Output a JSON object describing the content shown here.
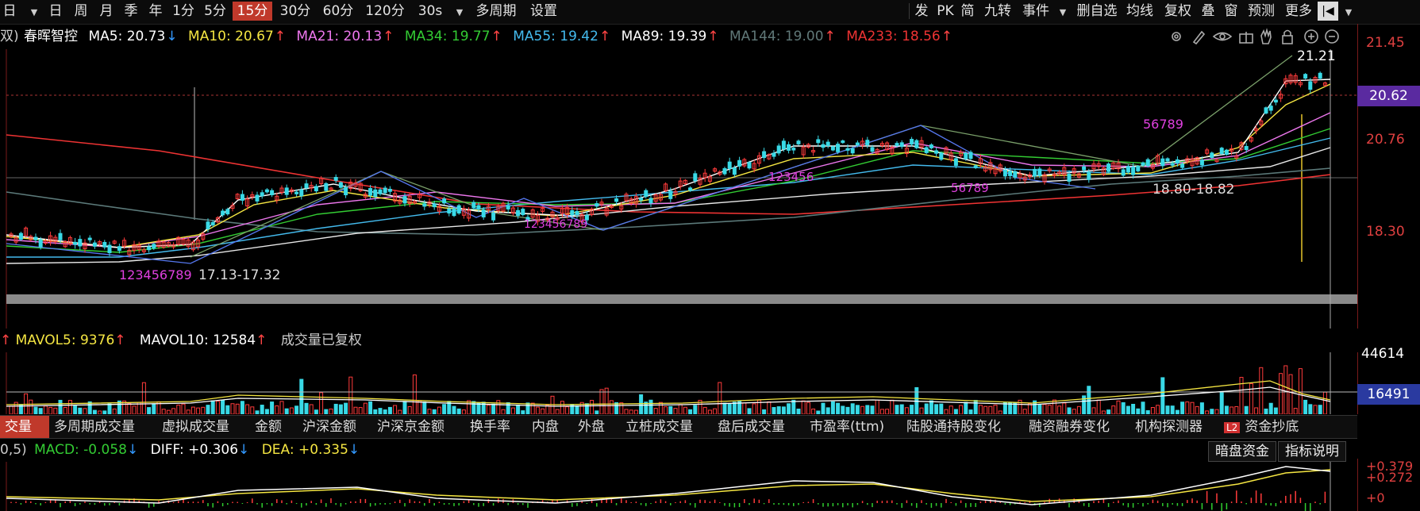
{
  "toolbar": {
    "left_items": [
      "日",
      "日",
      "周",
      "月",
      "季",
      "年",
      "1分",
      "5分",
      "15分",
      "30分",
      "60分",
      "120分",
      "30s",
      "多周期",
      "设置"
    ],
    "active": "15分",
    "right_items": [
      "发",
      "PK",
      "简",
      "九转",
      "事件",
      "删自选",
      "均线",
      "复权",
      "叠",
      "窗",
      "预测",
      "更多"
    ]
  },
  "header": {
    "prefix": "双)",
    "stock_name": "春晖智控",
    "ma": [
      {
        "label": "MA5: 20.73",
        "arrow": "↓",
        "color": "#ffffff"
      },
      {
        "label": "MA10: 20.67",
        "arrow": "↑",
        "color": "#f5e642"
      },
      {
        "label": "MA21: 20.13",
        "arrow": "↑",
        "color": "#ee77ee"
      },
      {
        "label": "MA34: 19.77",
        "arrow": "↑",
        "color": "#33cc33"
      },
      {
        "label": "MA55: 19.42",
        "arrow": "↑",
        "color": "#44bbee"
      },
      {
        "label": "MA89: 19.39",
        "arrow": "↑",
        "color": "#ffffff"
      },
      {
        "label": "MA144: 19.00",
        "arrow": "↑",
        "color": "#607878"
      },
      {
        "label": "MA233: 18.56",
        "arrow": "↑",
        "color": "#ee3333"
      }
    ],
    "icons": [
      "gear-icon",
      "pen-icon",
      "eye-icon",
      "gift-icon",
      "hand-icon",
      "lock-icon",
      "zoom-in-icon",
      "zoom-out-icon"
    ]
  },
  "price_axis": {
    "ticks": [
      "21.45",
      "20.76",
      "18.30"
    ],
    "current_tag": "20.62",
    "high_label": "21.21",
    "zone_label_high": "18.80-18.82",
    "zone_label_low": "17.13-17.32"
  },
  "volume": {
    "header": {
      "arrow1": "↑",
      "mavol5": "MAVOL5: 9376",
      "arrow2": "↑",
      "mavol10": "MAVOL10: 12584",
      "arrow3": "↑",
      "note": "成交量已复权"
    },
    "axis_top": "44614",
    "axis_tag": "16491"
  },
  "indicator_tabs": {
    "items": [
      "交量",
      "多周期成交量",
      "虚拟成交量",
      "金额",
      "沪深金额",
      "沪深京金额",
      "换手率",
      "内盘",
      "外盘",
      "立桩成交量",
      "盘后成交量",
      "市盈率(ttm)",
      "陆股通持股变化",
      "融资融券变化",
      "机构探测器"
    ],
    "selected": "交量",
    "l2_badge": "L2",
    "l2_label": "资金抄底"
  },
  "macd": {
    "prefix": "0,5)",
    "macd": "MACD: -0.058",
    "macd_arrow": "↓",
    "diff": "DIFF: +0.306",
    "diff_arrow": "↓",
    "dea": "DEA: +0.335",
    "dea_arrow": "↓",
    "buttons": [
      "暗盘资金",
      "指标说明"
    ],
    "axis": [
      "+0.379",
      "+0.272",
      "+0"
    ]
  },
  "sequence_digits": {
    "low": "123456789",
    "mid": "123456789",
    "high_a": "123456",
    "high_b": "56789",
    "right": "56789"
  }
}
